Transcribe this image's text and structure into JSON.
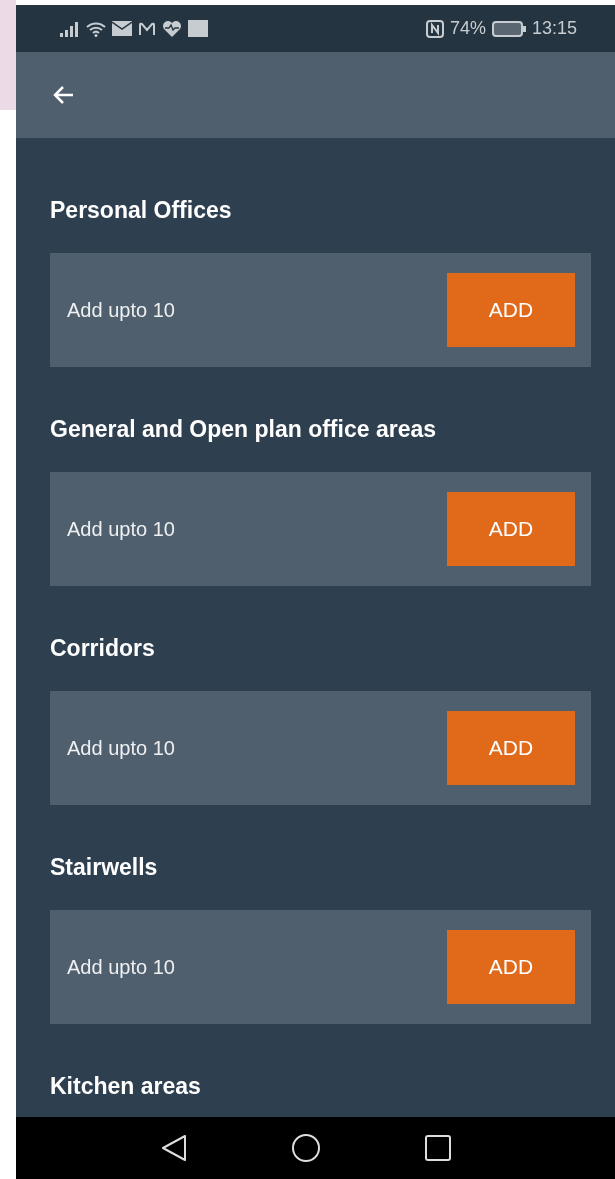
{
  "status_bar": {
    "battery": "74%",
    "time": "13:15"
  },
  "sections": [
    {
      "title": "Personal Offices",
      "hint": "Add upto 10",
      "button": "ADD"
    },
    {
      "title": "General and Open plan office areas",
      "hint": "Add upto 10",
      "button": "ADD"
    },
    {
      "title": "Corridors",
      "hint": "Add upto 10",
      "button": "ADD"
    },
    {
      "title": "Stairwells",
      "hint": "Add upto 10",
      "button": "ADD"
    },
    {
      "title": "Kitchen areas"
    }
  ]
}
